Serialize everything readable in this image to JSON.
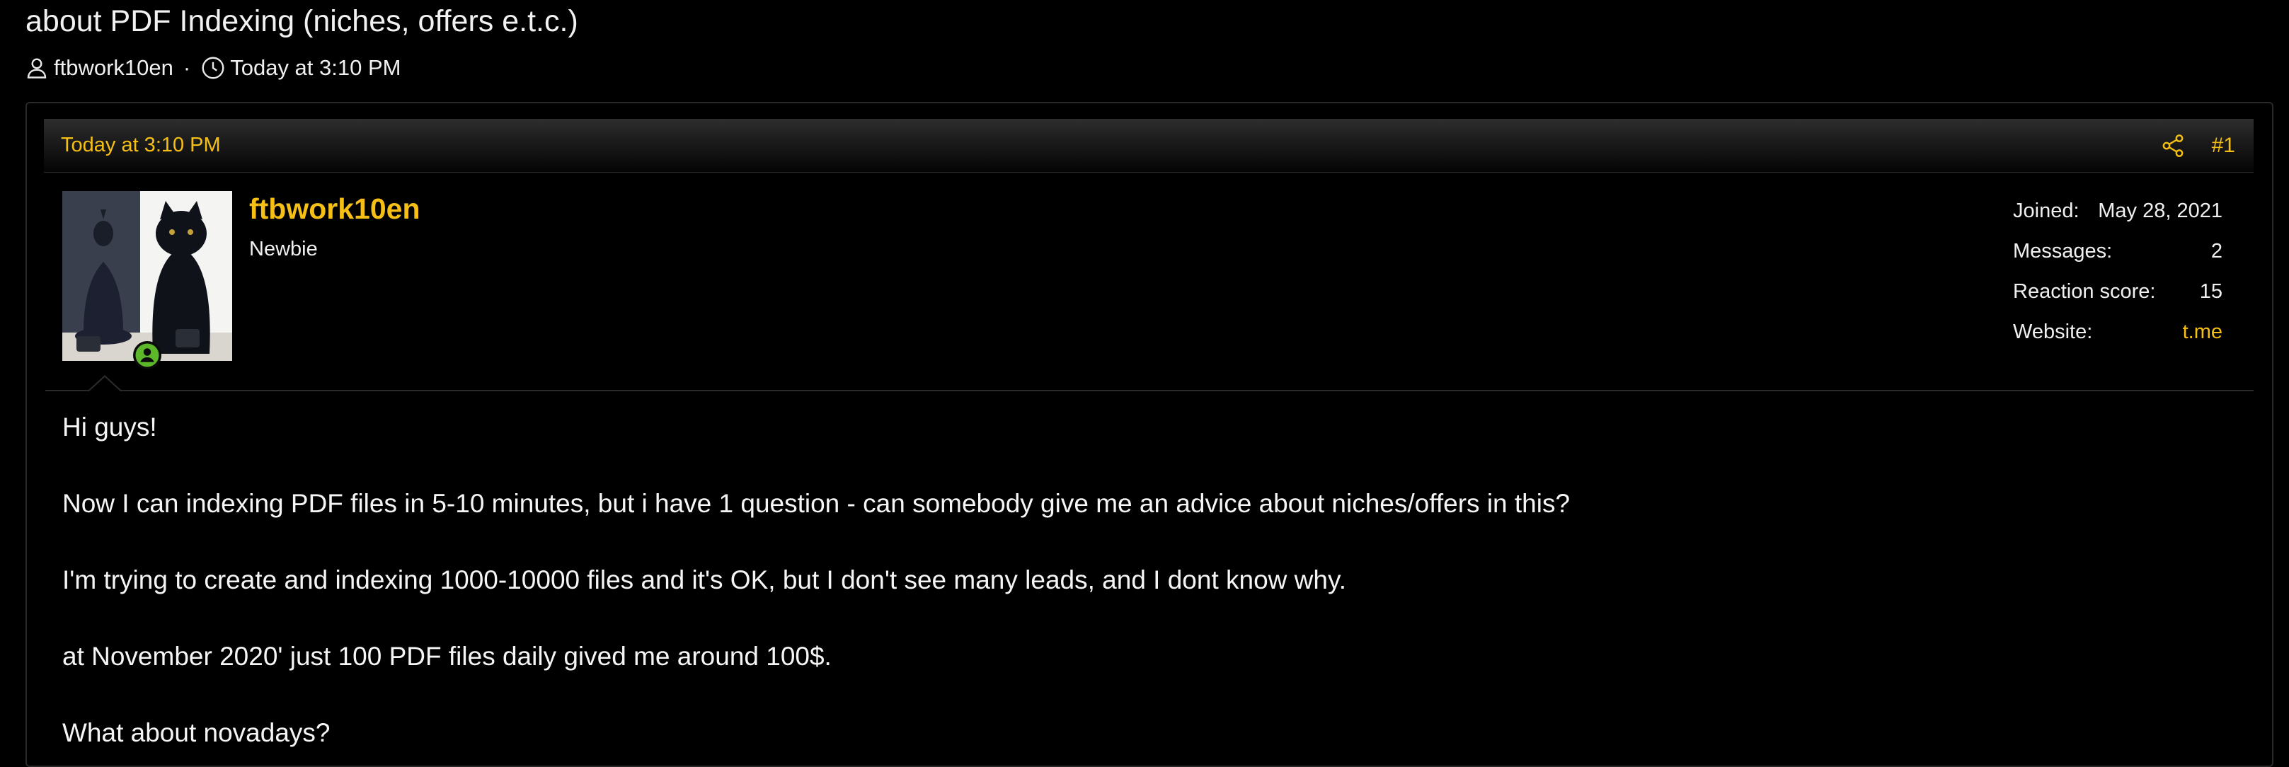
{
  "thread": {
    "title": "about PDF Indexing (niches, offers e.t.c.)",
    "author": "ftbwork10en",
    "separator": "·",
    "time": "Today at 3:10 PM"
  },
  "post": {
    "date": "Today at 3:10 PM",
    "number": "#1",
    "username": "ftbwork10en",
    "user_title": "Newbie",
    "stats": [
      {
        "label": "Joined:",
        "value": "May 28, 2021",
        "link": false
      },
      {
        "label": "Messages:",
        "value": "2",
        "link": false
      },
      {
        "label": "Reaction score:",
        "value": "15",
        "link": false
      },
      {
        "label": "Website:",
        "value": "t.me",
        "link": true
      }
    ],
    "body": [
      "Hi guys!",
      "Now I can indexing PDF files in 5-10 minutes, but i have 1 question - can somebody give me an advice about niches/offers in this?",
      "I'm trying to create and indexing 1000-10000 files and it's OK, but I don't see many leads, and I dont know why.",
      "at November 2020' just 100 PDF files daily gived me around 100$.",
      "What about novadays?"
    ]
  },
  "icons": {
    "author": "user-icon",
    "time": "clock-icon",
    "share": "share-icon",
    "online": "online-status-icon"
  },
  "colors": {
    "accent": "#f5bf16",
    "background": "#000000",
    "text": "#f0f0f0",
    "online": "#5cb82a"
  }
}
